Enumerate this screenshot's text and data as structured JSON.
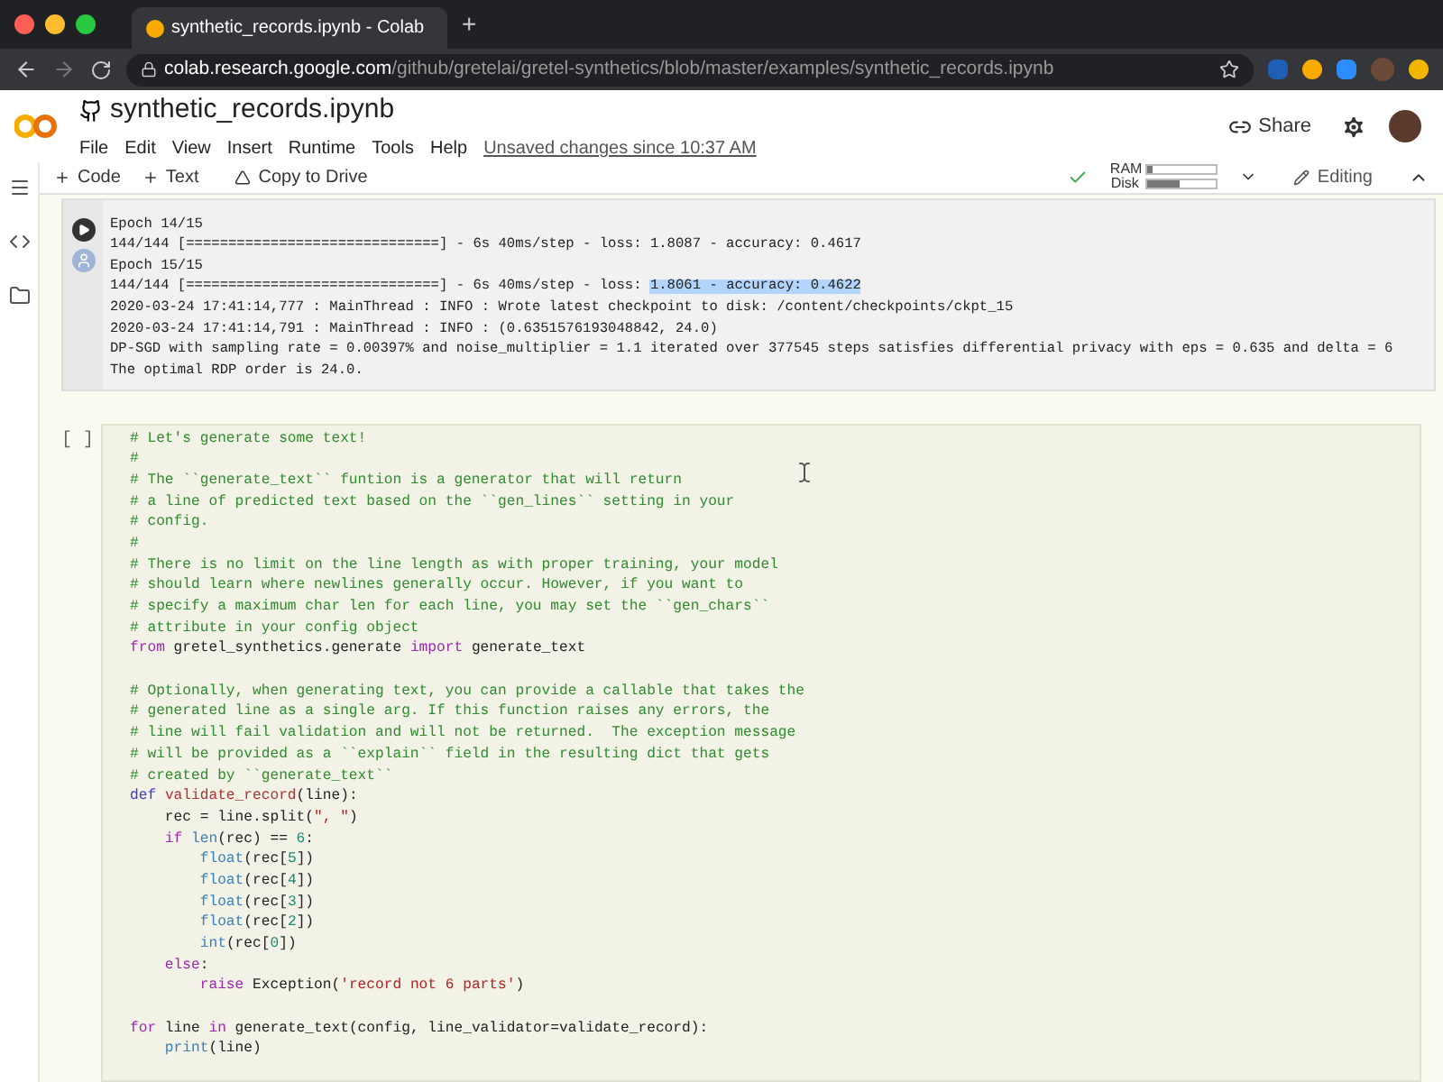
{
  "browser": {
    "tab_title": "synthetic_records.ipynb - Colab",
    "new_tab": "+",
    "url_host": "colab.research.google.com",
    "url_path": "/github/gretelai/gretel-synthetics/blob/master/examples/synthetic_records.ipynb"
  },
  "header": {
    "title": "synthetic_records.ipynb",
    "menu": [
      "File",
      "Edit",
      "View",
      "Insert",
      "Runtime",
      "Tools",
      "Help"
    ],
    "unsaved": "Unsaved changes since 10:37 AM",
    "share": "Share"
  },
  "toolbar": {
    "add_code": "Code",
    "add_text": "Text",
    "copy": "Copy to Drive",
    "ram_label": "RAM",
    "ram": {
      "level": 0.08
    },
    "disk_label": "Disk",
    "disk": {
      "level": 0.45
    },
    "editing": "Editing"
  },
  "output_lines": [
    [
      {
        "text": "Epoch 14/15",
        "selected": false
      }
    ],
    [
      {
        "text": "144/144 [==============================] - 6s 40ms/step - loss: 1.8087 - accuracy: 0.4617",
        "selected": false
      }
    ],
    [
      {
        "text": "Epoch 15/15",
        "selected": false
      }
    ],
    [
      {
        "text": "144/144 [==============================] - 6s 40ms/step - loss: ",
        "selected": false
      },
      {
        "text": "1.8061 - accuracy: 0.4622",
        "selected": true
      }
    ],
    [
      {
        "text": "2020-03-24 17:41:14,777 : MainThread : INFO : Wrote latest checkpoint to disk: /content/checkpoints/ckpt_15",
        "selected": false
      }
    ],
    [
      {
        "text": "2020-03-24 17:41:14,791 : MainThread : INFO : (0.6351576193048842, 24.0)",
        "selected": false
      }
    ],
    [
      {
        "text": "DP-SGD with sampling rate = 0.00397% and noise_multiplier = 1.1 iterated over 377545 steps satisfies differential privacy with eps = 0.635 and delta = 6",
        "selected": false
      }
    ],
    [
      {
        "text": "The optimal RDP order is 24.0.",
        "selected": false
      }
    ]
  ],
  "code_cell": {
    "prompt": "[ ]",
    "blocks": [
      [
        [
          {
            "kind": "comment",
            "text": "# Let's generate some text!"
          }
        ],
        [
          {
            "kind": "comment",
            "text": "#"
          }
        ],
        [
          {
            "kind": "comment",
            "text": "# The ``generate_text`` funtion is a generator that will return"
          }
        ],
        [
          {
            "kind": "comment",
            "text": "# a line of predicted text based on the ``gen_lines`` setting in your"
          }
        ],
        [
          {
            "kind": "comment",
            "text": "# config."
          }
        ],
        [
          {
            "kind": "comment",
            "text": "#"
          }
        ],
        [
          {
            "kind": "comment",
            "text": "# There is no limit on the line length as with proper training, your model"
          }
        ],
        [
          {
            "kind": "comment",
            "text": "# should learn where newlines generally occur. However, if you want to"
          }
        ],
        [
          {
            "kind": "comment",
            "text": "# specify a maximum char len for each line, you may set the ``gen_chars``"
          }
        ],
        [
          {
            "kind": "comment",
            "text": "# attribute in your config object"
          }
        ],
        [
          {
            "kind": "keyword",
            "text": "from"
          },
          {
            "kind": "plain",
            "text": " gretel_synthetics.generate "
          },
          {
            "kind": "keyword",
            "text": "import"
          },
          {
            "kind": "plain",
            "text": " generate_text"
          }
        ]
      ],
      [
        [
          {
            "kind": "comment",
            "text": "# Optionally, when generating text, you can provide a callable that takes the"
          }
        ],
        [
          {
            "kind": "comment",
            "text": "# generated line as a single arg. If this function raises any errors, the"
          }
        ],
        [
          {
            "kind": "comment",
            "text": "# line will fail validation and will not be returned.  The exception message"
          }
        ],
        [
          {
            "kind": "comment",
            "text": "# will be provided as a ``explain`` field in the resulting dict that gets"
          }
        ],
        [
          {
            "kind": "comment",
            "text": "# created by ``generate_text``"
          }
        ],
        [
          {
            "kind": "def",
            "text": "def "
          },
          {
            "kind": "fname",
            "text": "validate_record"
          },
          {
            "kind": "plain",
            "text": "(line):"
          }
        ],
        [
          {
            "kind": "plain",
            "text": "    rec = line.split("
          },
          {
            "kind": "string",
            "text": "\", \""
          },
          {
            "kind": "plain",
            "text": ")"
          }
        ],
        [
          {
            "kind": "keyword",
            "text": "    if "
          },
          {
            "kind": "builtin",
            "text": "len"
          },
          {
            "kind": "plain",
            "text": "(rec) == "
          },
          {
            "kind": "number",
            "text": "6"
          },
          {
            "kind": "plain",
            "text": ":"
          }
        ],
        [
          {
            "kind": "builtin",
            "text": "        float"
          },
          {
            "kind": "plain",
            "text": "(rec["
          },
          {
            "kind": "number",
            "text": "5"
          },
          {
            "kind": "plain",
            "text": "])"
          }
        ],
        [
          {
            "kind": "builtin",
            "text": "        float"
          },
          {
            "kind": "plain",
            "text": "(rec["
          },
          {
            "kind": "number",
            "text": "4"
          },
          {
            "kind": "plain",
            "text": "])"
          }
        ],
        [
          {
            "kind": "builtin",
            "text": "        float"
          },
          {
            "kind": "plain",
            "text": "(rec["
          },
          {
            "kind": "number",
            "text": "3"
          },
          {
            "kind": "plain",
            "text": "])"
          }
        ],
        [
          {
            "kind": "builtin",
            "text": "        float"
          },
          {
            "kind": "plain",
            "text": "(rec["
          },
          {
            "kind": "number",
            "text": "2"
          },
          {
            "kind": "plain",
            "text": "])"
          }
        ],
        [
          {
            "kind": "builtin",
            "text": "        int"
          },
          {
            "kind": "plain",
            "text": "(rec["
          },
          {
            "kind": "number",
            "text": "0"
          },
          {
            "kind": "plain",
            "text": "])"
          }
        ],
        [
          {
            "kind": "keyword",
            "text": "    else"
          },
          {
            "kind": "plain",
            "text": ":"
          }
        ],
        [
          {
            "kind": "keyword",
            "text": "        raise"
          },
          {
            "kind": "plain",
            "text": " Exception("
          },
          {
            "kind": "string",
            "text": "'record not 6 parts'"
          },
          {
            "kind": "plain",
            "text": ")"
          }
        ]
      ],
      [
        [
          {
            "kind": "keyword",
            "text": "for"
          },
          {
            "kind": "plain",
            "text": " line "
          },
          {
            "kind": "keyword",
            "text": "in"
          },
          {
            "kind": "plain",
            "text": " generate_text(config, line_validator=validate_record):"
          }
        ],
        [
          {
            "kind": "builtin",
            "text": "    print"
          },
          {
            "kind": "plain",
            "text": "(line)"
          }
        ]
      ]
    ]
  }
}
